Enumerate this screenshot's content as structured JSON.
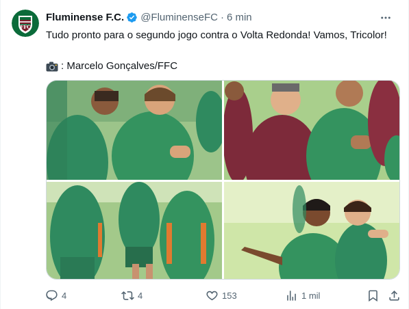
{
  "tweet": {
    "author_name": "Fluminense F.C.",
    "handle": "@FluminenseFC",
    "separator": "·",
    "time": "6 min",
    "text": "Tudo pronto para o segundo jogo contra o Volta Redonda! Vamos, Tricolor!",
    "credit_text": ": Marcelo Gonçalves/FFC",
    "more_icon": "more-horizontal-icon",
    "verified_color": "#1d9bf0",
    "avatar_colors": {
      "maroon": "#7a1f2b",
      "green": "#0b6b3a",
      "white": "#ffffff"
    }
  },
  "media": {
    "count": 4,
    "images": [
      {
        "description_key": "players-training-smiling-1"
      },
      {
        "description_key": "coach-and-player-2"
      },
      {
        "description_key": "players-back-view-3"
      },
      {
        "description_key": "players-pointing-4"
      }
    ]
  },
  "actions": {
    "reply_count": "4",
    "retweet_count": "4",
    "like_count": "153",
    "views_count": "1 mil",
    "icons": [
      "reply-icon",
      "retweet-icon",
      "like-icon",
      "views-icon",
      "bookmark-icon",
      "share-icon"
    ]
  },
  "colors": {
    "text_primary": "#0f1419",
    "text_secondary": "#536471",
    "accent": "#1d9bf0",
    "jersey_green": "#2f8a5f",
    "jersey_maroon": "#7d2a3a",
    "grass": "#8fbf6a"
  }
}
